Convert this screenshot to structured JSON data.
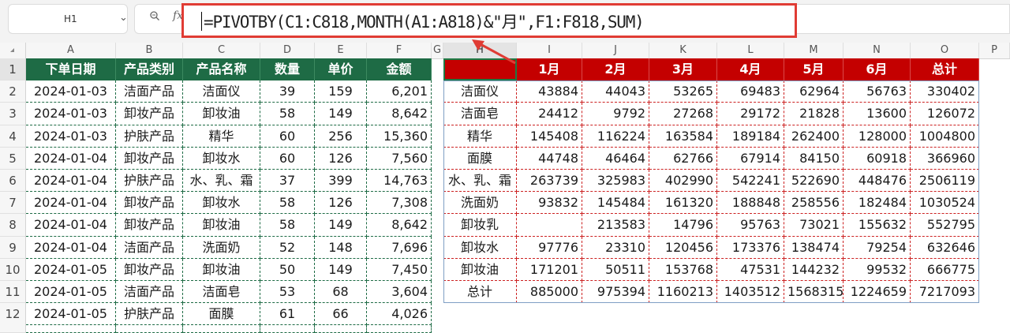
{
  "formula_bar": {
    "cell_ref": "H1",
    "fx": "fx",
    "formula": "=PIVOTBY(C1:C818,MONTH(A1:A818)&\"月\",F1:F818,SUM)"
  },
  "columns": [
    "A",
    "B",
    "C",
    "D",
    "E",
    "F",
    "G",
    "H",
    "I",
    "J",
    "K",
    "L",
    "M",
    "N",
    "O",
    "P"
  ],
  "rows": [
    "1",
    "2",
    "3",
    "4",
    "5",
    "6",
    "7",
    "8",
    "9",
    "10",
    "11",
    "12"
  ],
  "source_table": {
    "headers": [
      "下单日期",
      "产品类别",
      "产品名称",
      "数量",
      "单价",
      "金额"
    ],
    "rows": [
      [
        "2024-01-03",
        "洁面产品",
        "洁面仪",
        "39",
        "159",
        "6,201"
      ],
      [
        "2024-01-03",
        "卸妆产品",
        "卸妆油",
        "58",
        "149",
        "8,642"
      ],
      [
        "2024-01-03",
        "护肤产品",
        "精华",
        "60",
        "256",
        "15,360"
      ],
      [
        "2024-01-04",
        "卸妆产品",
        "卸妆水",
        "60",
        "126",
        "7,560"
      ],
      [
        "2024-01-04",
        "护肤产品",
        "水、乳、霜",
        "37",
        "399",
        "14,763"
      ],
      [
        "2024-01-04",
        "卸妆产品",
        "卸妆水",
        "58",
        "126",
        "7,308"
      ],
      [
        "2024-01-04",
        "卸妆产品",
        "卸妆油",
        "58",
        "149",
        "8,642"
      ],
      [
        "2024-01-04",
        "洁面产品",
        "洗面奶",
        "52",
        "148",
        "7,696"
      ],
      [
        "2024-01-05",
        "卸妆产品",
        "卸妆油",
        "50",
        "149",
        "7,450"
      ],
      [
        "2024-01-05",
        "洁面产品",
        "洁面皂",
        "53",
        "68",
        "3,604"
      ],
      [
        "2024-01-05",
        "护肤产品",
        "面膜",
        "61",
        "66",
        "4,026"
      ]
    ]
  },
  "pivot_table": {
    "headers": [
      "",
      "1月",
      "2月",
      "3月",
      "4月",
      "5月",
      "6月",
      "总计"
    ],
    "rows": [
      [
        "洁面仪",
        "43884",
        "44043",
        "53265",
        "69483",
        "62964",
        "56763",
        "330402"
      ],
      [
        "洁面皂",
        "24412",
        "9792",
        "27268",
        "29172",
        "21828",
        "13600",
        "126072"
      ],
      [
        "精华",
        "145408",
        "116224",
        "163584",
        "189184",
        "262400",
        "128000",
        "1004800"
      ],
      [
        "面膜",
        "44748",
        "46464",
        "62766",
        "67914",
        "84150",
        "60918",
        "366960"
      ],
      [
        "水、乳、霜",
        "263739",
        "325983",
        "402990",
        "542241",
        "522690",
        "448476",
        "2506119"
      ],
      [
        "洗面奶",
        "93832",
        "145484",
        "161320",
        "188848",
        "258556",
        "182484",
        "1030524"
      ],
      [
        "卸妆乳",
        "",
        "213583",
        "14796",
        "95763",
        "73021",
        "155632",
        "552795"
      ],
      [
        "卸妆水",
        "97776",
        "23310",
        "120456",
        "173376",
        "138474",
        "79254",
        "632646"
      ],
      [
        "卸妆油",
        "171201",
        "50511",
        "153768",
        "47531",
        "144232",
        "99532",
        "666775"
      ],
      [
        "总计",
        "885000",
        "975394",
        "1160213",
        "1403512",
        "1568315",
        "1224659",
        "7217093"
      ]
    ]
  },
  "colors": {
    "source_header_bg": "#1e6b45",
    "pivot_header_bg": "#c40000",
    "highlight_border": "#e03c34"
  }
}
